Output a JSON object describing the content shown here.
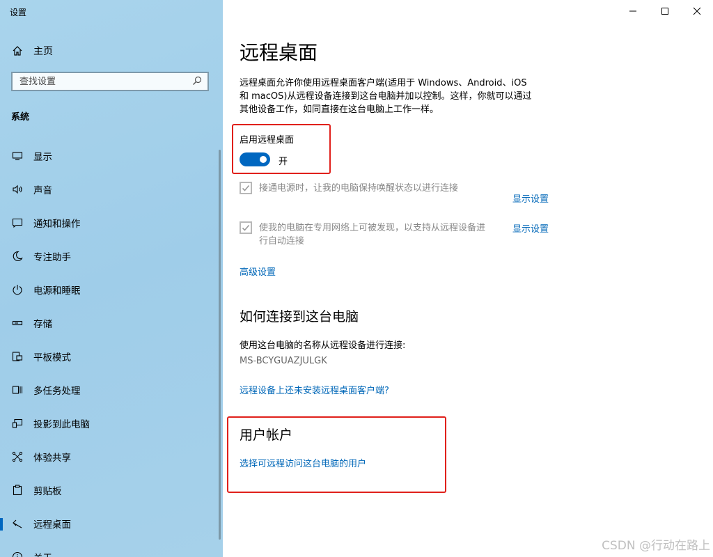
{
  "window": {
    "title": "设置",
    "controls": {
      "minimize": "minimize-icon",
      "maximize": "maximize-icon",
      "close": "close-icon"
    }
  },
  "sidebar": {
    "home_label": "主页",
    "search_placeholder": "查找设置",
    "section_label": "系统",
    "items": [
      {
        "label": "显示",
        "icon": "monitor-icon"
      },
      {
        "label": "声音",
        "icon": "speaker-icon"
      },
      {
        "label": "通知和操作",
        "icon": "notification-icon"
      },
      {
        "label": "专注助手",
        "icon": "moon-icon"
      },
      {
        "label": "电源和睡眠",
        "icon": "power-icon"
      },
      {
        "label": "存储",
        "icon": "storage-icon"
      },
      {
        "label": "平板模式",
        "icon": "tablet-icon"
      },
      {
        "label": "多任务处理",
        "icon": "multitask-icon"
      },
      {
        "label": "投影到此电脑",
        "icon": "project-icon"
      },
      {
        "label": "体验共享",
        "icon": "share-icon"
      },
      {
        "label": "剪贴板",
        "icon": "clipboard-icon"
      },
      {
        "label": "远程桌面",
        "icon": "remote-desktop-icon",
        "active": true
      },
      {
        "label": "关于",
        "icon": "info-icon"
      }
    ]
  },
  "main": {
    "title": "远程桌面",
    "description_lines": [
      "远程桌面允许你使用远程桌面客户端(适用于 Windows、Android、iOS",
      "和 macOS)从远程设备连接到这台电脑并加以控制。这样，你就可以通过",
      "其他设备工作，如同直接在这台电脑上工作一样。"
    ],
    "toggle_label": "启用远程桌面",
    "toggle_state": "开",
    "toggle_on": true,
    "option1_text": "接通电源时，让我的电脑保持唤醒状态以进行连接",
    "option1_link": "显示设置",
    "option2_lines": [
      "使我的电脑在专用网络上可被发现，以支持从远程设备进",
      "行自动连接"
    ],
    "option2_link": "显示设置",
    "advanced_link": "高级设置",
    "how_title": "如何连接到这台电脑",
    "how_desc": "使用这台电脑的名称从远程设备进行连接:",
    "pc_name": "MS-BCYGUAZJULGK",
    "client_link": "远程设备上还未安装远程桌面客户端?",
    "accounts_title": "用户帐户",
    "accounts_link": "选择可远程访问这台电脑的用户"
  },
  "watermark": "CSDN @行动在路上",
  "colors": {
    "accent": "#0067c0",
    "link": "#0067b8",
    "highlight_box": "#e0201b",
    "sidebar_bg": "#a6d1ea"
  }
}
